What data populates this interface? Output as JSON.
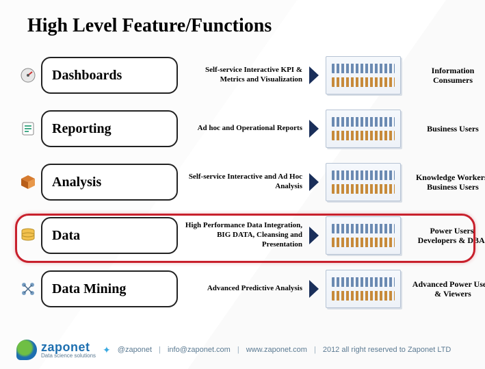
{
  "title": "High Level Feature/Functions",
  "rows": [
    {
      "label": "Dashboards",
      "desc": "Self-service Interactive KPI & Metrics and Visualization",
      "audience": "Information Consumers",
      "icon": "dashboard-icon"
    },
    {
      "label": "Reporting",
      "desc": "Ad hoc and Operational Reports",
      "audience": "Business Users",
      "icon": "report-icon"
    },
    {
      "label": "Analysis",
      "desc": "Self-service Interactive and Ad Hoc Analysis",
      "audience": "Knowledge Workers/ Business Users",
      "icon": "cube-icon"
    },
    {
      "label": "Data",
      "desc": "High Performance Data Integration, BIG DATA, Cleansing and Presentation",
      "audience": "Power Users, Developers & DBAs",
      "icon": "database-icon"
    },
    {
      "label": "Data Mining",
      "desc": "Advanced Predictive Analysis",
      "audience": "Advanced Power Users & Viewers",
      "icon": "mining-icon"
    }
  ],
  "highlighted_row_index": 2,
  "footer": {
    "brand": "zaponet",
    "tagline": "Data science solutions",
    "twitter": "@zaponet",
    "email": "info@zaponet.com",
    "site": "www.zaponet.com",
    "rights": "2012 all right reserved to Zaponet LTD"
  },
  "colors": {
    "highlight": "#c8202c",
    "arrow": "#1a2f5a"
  }
}
